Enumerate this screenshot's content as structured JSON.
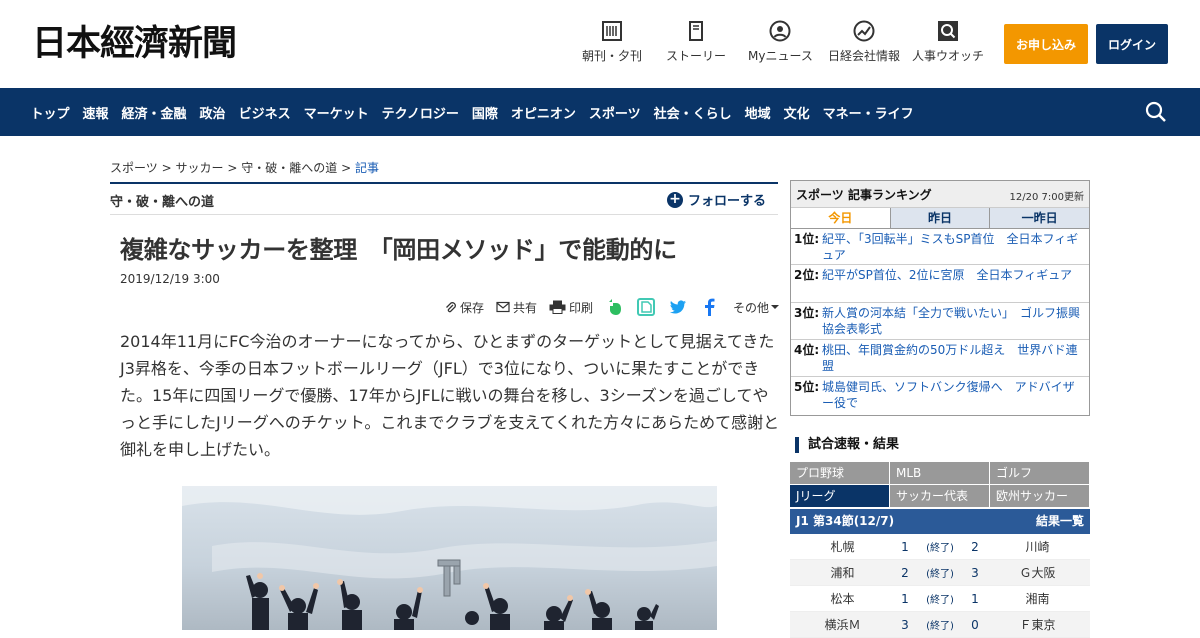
{
  "header": {
    "logo": "日本經濟新聞",
    "nav": [
      {
        "label": "朝刊・夕刊",
        "icon": "newspaper-icon"
      },
      {
        "label": "ストーリー",
        "icon": "book-icon"
      },
      {
        "label": "Myニュース",
        "icon": "person-icon"
      },
      {
        "label": "日経会社情報",
        "icon": "chart-icon"
      },
      {
        "label": "人事ウオッチ",
        "icon": "magnifier-icon"
      }
    ],
    "subscribe": "お申し込み",
    "login": "ログイン"
  },
  "navbar": {
    "items": [
      "トップ",
      "速報",
      "経済・金融",
      "政治",
      "ビジネス",
      "マーケット",
      "テクノロジー",
      "国際",
      "オピニオン",
      "スポーツ",
      "社会・くらし",
      "地域",
      "文化",
      "マネー・ライフ"
    ]
  },
  "breadcrumb": {
    "items": [
      "スポーツ",
      "サッカー",
      "守・破・離への道"
    ],
    "sep": ">",
    "current": "記事"
  },
  "series": {
    "name": "守・破・離への道",
    "follow": "フォローする"
  },
  "article": {
    "headline": "複雑なサッカーを整理　「岡田メソッド」で能動的に",
    "date": "2019/12/19 3:00",
    "tools": {
      "save": "保存",
      "share": "共有",
      "print": "印刷",
      "more": "その他"
    },
    "body": "2014年11月にFC今治のオーナーになってから、ひとまずのターゲットとして見据えてきたJ3昇格を、今季の日本フットボールリーグ（JFL）で3位になり、ついに果たすことができた。15年に四国リーグで優勝、17年からJFLに戦いの舞台を移し、3シーズンを過ごしてやっと手にしたJリーグへのチケット。これまでクラブを支えてくれた方々にあらためて感謝と御礼を申し上げたい。"
  },
  "ranking": {
    "title": "スポーツ 記事ランキング",
    "updated": "12/20 7:00更新",
    "tabs": [
      "今日",
      "昨日",
      "一昨日"
    ],
    "items": [
      {
        "rank": "1位:",
        "text": "紀平、「3回転半」ミスもSP首位　全日本フィギュア"
      },
      {
        "rank": "2位:",
        "text": "紀平がSP首位、2位に宮原　全日本フィギュア"
      },
      {
        "rank": "3位:",
        "text": "新人賞の河本結「全力で戦いたい」　ゴルフ振興協会表彰式"
      },
      {
        "rank": "4位:",
        "text": "桃田、年間賞金約の50万ドル超え　世界バド連盟"
      },
      {
        "rank": "5位:",
        "text": "城島健司氏、ソフトバンク復帰へ　アドバイザー役で"
      }
    ]
  },
  "results": {
    "title": "試合速報・結果",
    "tabs": [
      "プロ野球",
      "MLB",
      "ゴルフ",
      "Jリーグ",
      "サッカー代表",
      "欧州サッカー"
    ],
    "active_tab": "Jリーグ",
    "round": "J1 第34節(12/7)",
    "list_link": "結果一覧",
    "matches": [
      {
        "home": "札幌",
        "hs": "1",
        "status": "(終了)",
        "as": "2",
        "away": "川崎"
      },
      {
        "home": "浦和",
        "hs": "2",
        "status": "(終了)",
        "as": "3",
        "away": "Ｇ大阪"
      },
      {
        "home": "松本",
        "hs": "1",
        "status": "(終了)",
        "as": "1",
        "away": "湘南"
      },
      {
        "home": "横浜Ｍ",
        "hs": "3",
        "status": "(終了)",
        "as": "0",
        "away": "Ｆ東京"
      }
    ]
  },
  "colors": {
    "navy": "#0a3467",
    "orange": "#f39700",
    "link": "#1a5db4"
  }
}
